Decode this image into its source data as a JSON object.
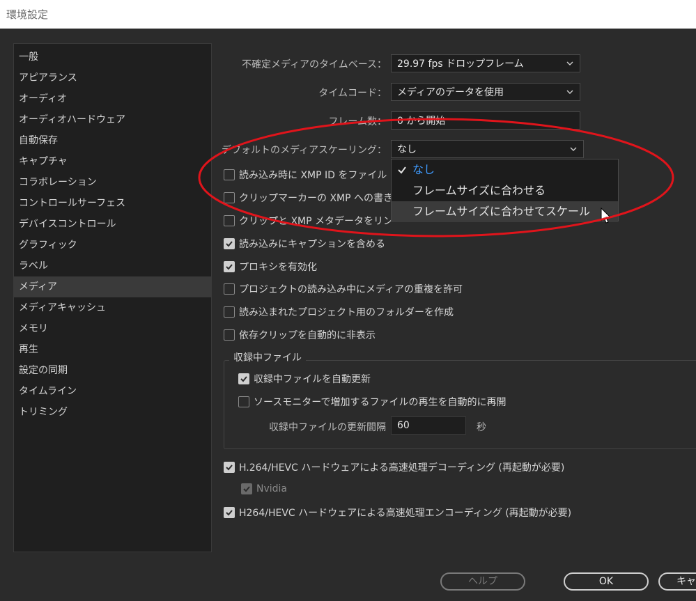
{
  "window": {
    "title": "環境設定"
  },
  "sidebar": {
    "items": [
      {
        "label": "一般",
        "active": false
      },
      {
        "label": "アピアランス",
        "active": false
      },
      {
        "label": "オーディオ",
        "active": false
      },
      {
        "label": "オーディオハードウェア",
        "active": false
      },
      {
        "label": "自動保存",
        "active": false
      },
      {
        "label": "キャプチャ",
        "active": false
      },
      {
        "label": "コラボレーション",
        "active": false
      },
      {
        "label": "コントロールサーフェス",
        "active": false
      },
      {
        "label": "デバイスコントロール",
        "active": false
      },
      {
        "label": "グラフィック",
        "active": false
      },
      {
        "label": "ラベル",
        "active": false
      },
      {
        "label": "メディア",
        "active": true
      },
      {
        "label": "メディアキャッシュ",
        "active": false
      },
      {
        "label": "メモリ",
        "active": false
      },
      {
        "label": "再生",
        "active": false
      },
      {
        "label": "設定の同期",
        "active": false
      },
      {
        "label": "タイムライン",
        "active": false
      },
      {
        "label": "トリミング",
        "active": false
      }
    ]
  },
  "settings": {
    "timebase": {
      "label": "不確定メディアのタイムベース：",
      "value": "29.97  fps ドロップフレーム"
    },
    "timecode": {
      "label": "タイムコード：",
      "value": "メディアのデータを使用"
    },
    "frame_count": {
      "label": "フレーム数：",
      "value": "0 から開始"
    },
    "scaling": {
      "label": "デフォルトのメディアスケーリング：",
      "value": "なし",
      "options": [
        "なし",
        "フレームサイズに合わせる",
        "フレームサイズに合わせてスケール"
      ]
    }
  },
  "checkboxes": [
    {
      "label": "読み込み時に XMP ID をファイル",
      "checked": false
    },
    {
      "label": "クリップマーカーの XMP への書き",
      "checked": false
    },
    {
      "label": "クリップと XMP メタデータをリン",
      "checked": false
    },
    {
      "label": "読み込みにキャプションを含める",
      "checked": true
    },
    {
      "label": "プロキシを有効化",
      "checked": true
    },
    {
      "label": "プロジェクトの読み込み中にメディアの重複を許可",
      "checked": false
    },
    {
      "label": "読み込まれたプロジェクト用のフォルダーを作成",
      "checked": false
    },
    {
      "label": "依存クリップを自動的に非表示",
      "checked": false
    }
  ],
  "growing_files": {
    "title": "収録中ファイル",
    "auto_refresh": {
      "label": "収録中ファイルを自動更新",
      "checked": true
    },
    "resume_playback": {
      "label": "ソースモニターで増加するファイルの再生を自動的に再開",
      "checked": false
    },
    "interval_label": "収録中ファイルの更新間隔",
    "interval_value": "60",
    "interval_unit": "秒"
  },
  "hardware": {
    "decode": {
      "label": "H.264/HEVC ハードウェアによる高速処理デコーディング (再起動が必要)",
      "checked": true
    },
    "nvidia": {
      "label": "Nvidia",
      "checked": true,
      "disabled": true
    },
    "encode": {
      "label": "H264/HEVC ハードウェアによる高速処理エンコーディング (再起動が必要)",
      "checked": true
    }
  },
  "buttons": {
    "help": "ヘルプ",
    "ok": "OK",
    "cancel": "キャ"
  },
  "colors": {
    "highlight_ellipse": "#e0141b",
    "selected_option": "#3f9bff"
  }
}
